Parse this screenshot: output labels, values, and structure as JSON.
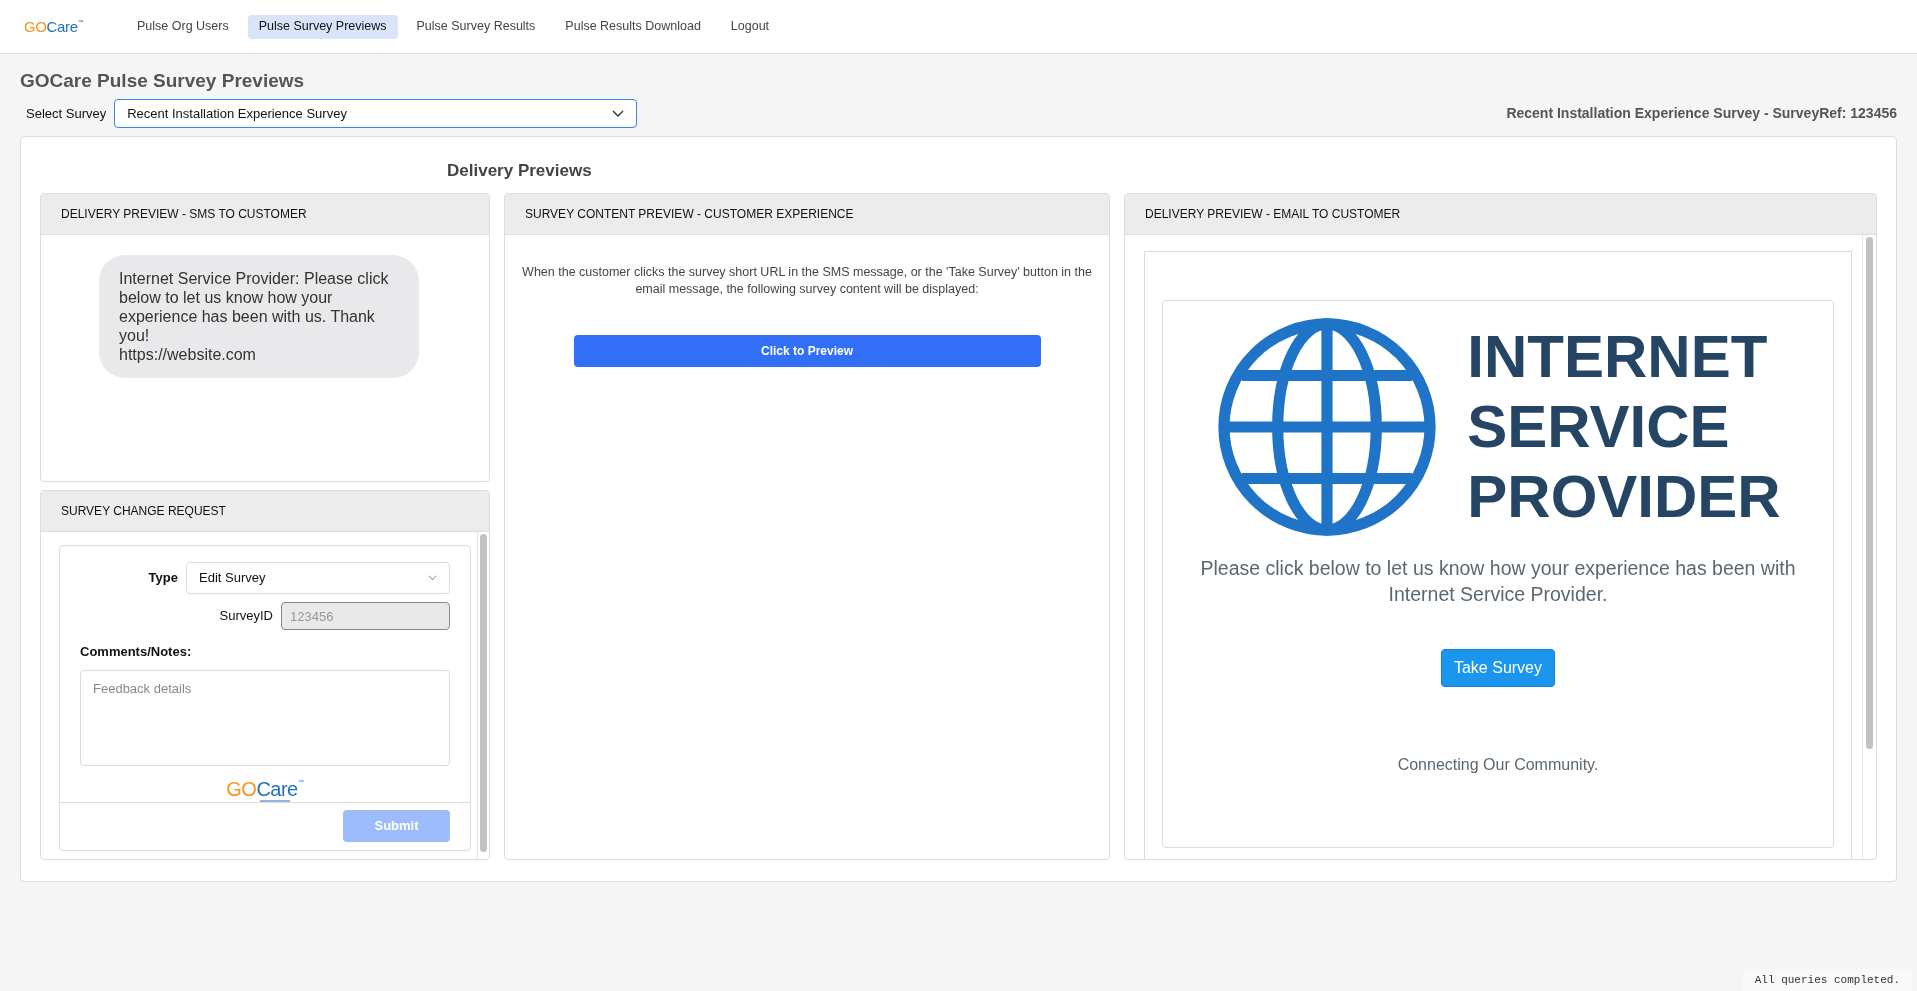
{
  "nav": {
    "logo": {
      "first": "GO",
      "second": "Care",
      "mark": "™"
    },
    "items": [
      {
        "label": "Pulse Org Users",
        "selected": false
      },
      {
        "label": "Pulse Survey Previews",
        "selected": true
      },
      {
        "label": "Pulse Survey Results",
        "selected": false
      },
      {
        "label": "Pulse Results Download",
        "selected": false
      },
      {
        "label": "Logout",
        "selected": false
      }
    ]
  },
  "page_title": "GOCare Pulse Survey Previews",
  "select_survey": {
    "label": "Select Survey",
    "value": "Recent Installation Experience Survey"
  },
  "survey_ref": {
    "text": "Recent Installation Experience Survey - SurveyRef:",
    "number": "123456"
  },
  "section_title": "Delivery Previews",
  "sms_panel": {
    "title": "DELIVERY PREVIEW - SMS TO CUSTOMER",
    "message": "Internet Service Provider: Please click below to let us know how your experience has been with us. Thank you!",
    "link": "https://website.com"
  },
  "change_request": {
    "title": "SURVEY CHANGE REQUEST",
    "type_label": "Type",
    "type_value": "Edit Survey",
    "survey_id_label": "SurveyID",
    "survey_id_value": "123456",
    "comments_label": "Comments/Notes:",
    "comments_placeholder": "Feedback details",
    "logo": {
      "first": "GO",
      "second": "Care",
      "mark": "™"
    },
    "submit": {
      "label": "Submit",
      "disabled": true
    }
  },
  "content_panel": {
    "title": "SURVEY CONTENT PREVIEW - CUSTOMER EXPERIENCE",
    "description": "When the customer clicks the survey short URL in the SMS message, or the 'Take Survey' button in the email message, the following survey content will be displayed:",
    "button": "Click to Preview"
  },
  "email_panel": {
    "title": "DELIVERY PREVIEW - EMAIL TO CUSTOMER",
    "brand_lines": [
      "INTERNET",
      "SERVICE",
      "PROVIDER"
    ],
    "message": "Please click below to let us know how your experience has been with Internet Service Provider.",
    "button": "Take Survey",
    "footer": "Connecting Our Community."
  },
  "status": "All queries completed."
}
